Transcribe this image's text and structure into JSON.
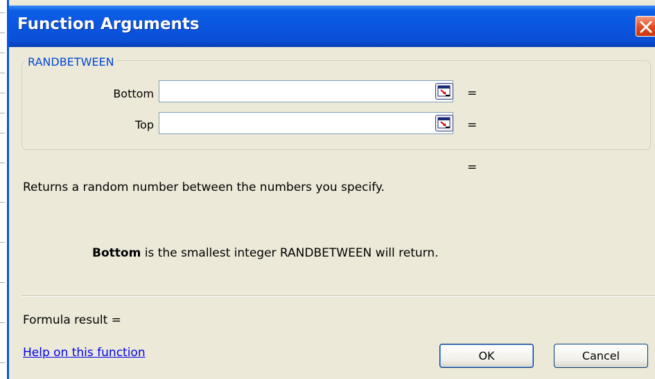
{
  "dialog": {
    "title": "Function Arguments",
    "close_icon": "close-icon"
  },
  "function_group": {
    "name": "RANDBETWEEN",
    "arguments": [
      {
        "label": "Bottom",
        "value": "",
        "equals": "="
      },
      {
        "label": "Top",
        "value": "",
        "equals": "="
      }
    ],
    "collapse_icon": "collapse-dialog-icon"
  },
  "result_equals": "=",
  "description": "Returns a random number between the numbers you specify.",
  "argument_help": {
    "arg_name": "Bottom",
    "text": " is the smallest integer RANDBETWEEN will return."
  },
  "formula_result": "Formula result =",
  "help_link": "Help on this function",
  "buttons": {
    "ok": "OK",
    "cancel": "Cancel"
  },
  "colors": {
    "titlebar": "#0a55e0",
    "dialog_bg": "#ece9d8",
    "group_label": "#0046d5",
    "link": "#0000ee",
    "close": "#e2481e"
  }
}
